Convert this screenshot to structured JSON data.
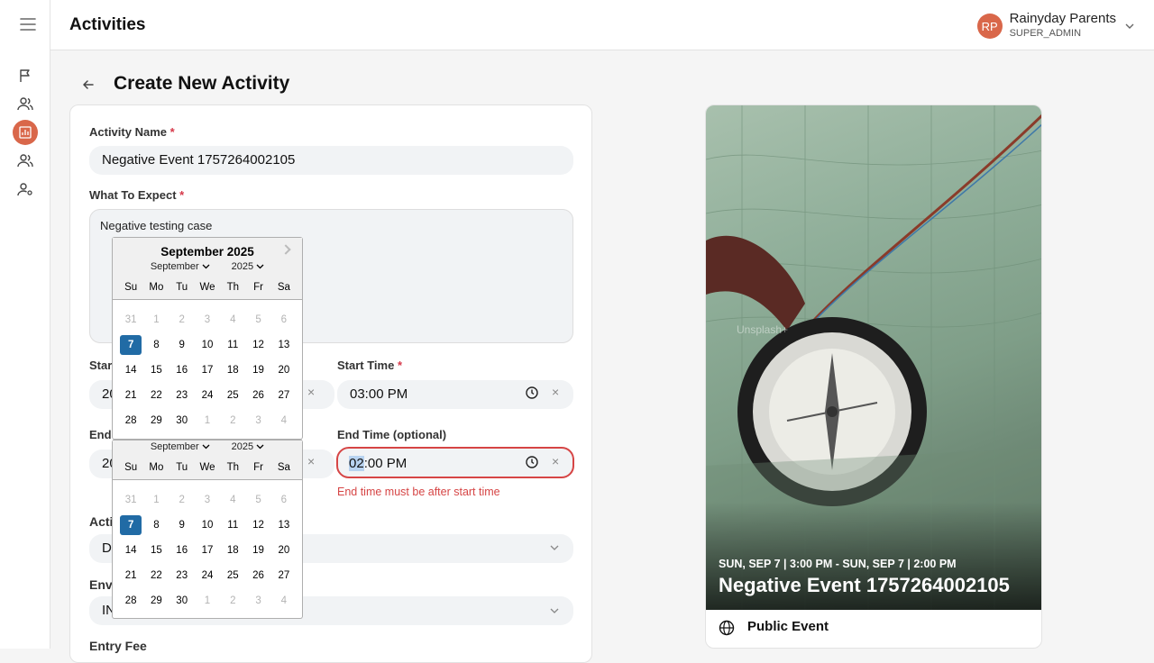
{
  "app": {
    "title": "Activities"
  },
  "user": {
    "initials": "RP",
    "name": "Rainyday Parents",
    "role": "SUPER_ADMIN"
  },
  "page": {
    "title": "Create New Activity"
  },
  "form": {
    "activity_name_label": "Activity Name",
    "activity_name_value": "Negative Event 1757264002105",
    "what_to_expect_label": "What To Expect",
    "what_to_expect_value": "Negative testing case",
    "start_date_label_partial": "Star",
    "start_date_value_partial": "20",
    "start_time_label": "Start Time",
    "start_time_value": "03:00 PM",
    "end_date_label_partial": "End",
    "end_date_value_partial": "20",
    "end_time_label": "End Time (optional)",
    "end_time_value_hour": "02",
    "end_time_value_rest": ":00 PM",
    "end_time_error": "End time must be after start time",
    "activity_type_label_partial": "Acti",
    "activity_type_value_partial": "D",
    "environment_label_partial": "Env",
    "environment_value_partial": "IN",
    "entry_fee_label": "Entry Fee",
    "required_mark": "*",
    "clear_symbol": "×"
  },
  "calendar_start": {
    "title": "September 2025",
    "month_select": "September",
    "year_select": "2025",
    "day_names": [
      "Su",
      "Mo",
      "Tu",
      "We",
      "Th",
      "Fr",
      "Sa"
    ],
    "weeks": [
      [
        "31",
        "1",
        "2",
        "3",
        "4",
        "5",
        "6"
      ],
      [
        "7",
        "8",
        "9",
        "10",
        "11",
        "12",
        "13"
      ],
      [
        "14",
        "15",
        "16",
        "17",
        "18",
        "19",
        "20"
      ],
      [
        "21",
        "22",
        "23",
        "24",
        "25",
        "26",
        "27"
      ],
      [
        "28",
        "29",
        "30",
        "1",
        "2",
        "3",
        "4"
      ]
    ],
    "selected": "7"
  },
  "calendar_end": {
    "month_select": "September",
    "year_select": "2025",
    "day_names": [
      "Su",
      "Mo",
      "Tu",
      "We",
      "Th",
      "Fr",
      "Sa"
    ],
    "weeks": [
      [
        "31",
        "1",
        "2",
        "3",
        "4",
        "5",
        "6"
      ],
      [
        "7",
        "8",
        "9",
        "10",
        "11",
        "12",
        "13"
      ],
      [
        "14",
        "15",
        "16",
        "17",
        "18",
        "19",
        "20"
      ],
      [
        "21",
        "22",
        "23",
        "24",
        "25",
        "26",
        "27"
      ],
      [
        "28",
        "29",
        "30",
        "1",
        "2",
        "3",
        "4"
      ]
    ],
    "selected": "7"
  },
  "preview": {
    "date_range": "SUN, SEP 7 | 3:00 PM - SUN, SEP 7 | 2:00 PM",
    "event_name": "Negative Event 1757264002105",
    "event_type": "Public Event",
    "watermark": "Unsplash+"
  },
  "colors": {
    "accent": "#d9674a",
    "error": "#d64545",
    "selected_day": "#216ba5"
  }
}
